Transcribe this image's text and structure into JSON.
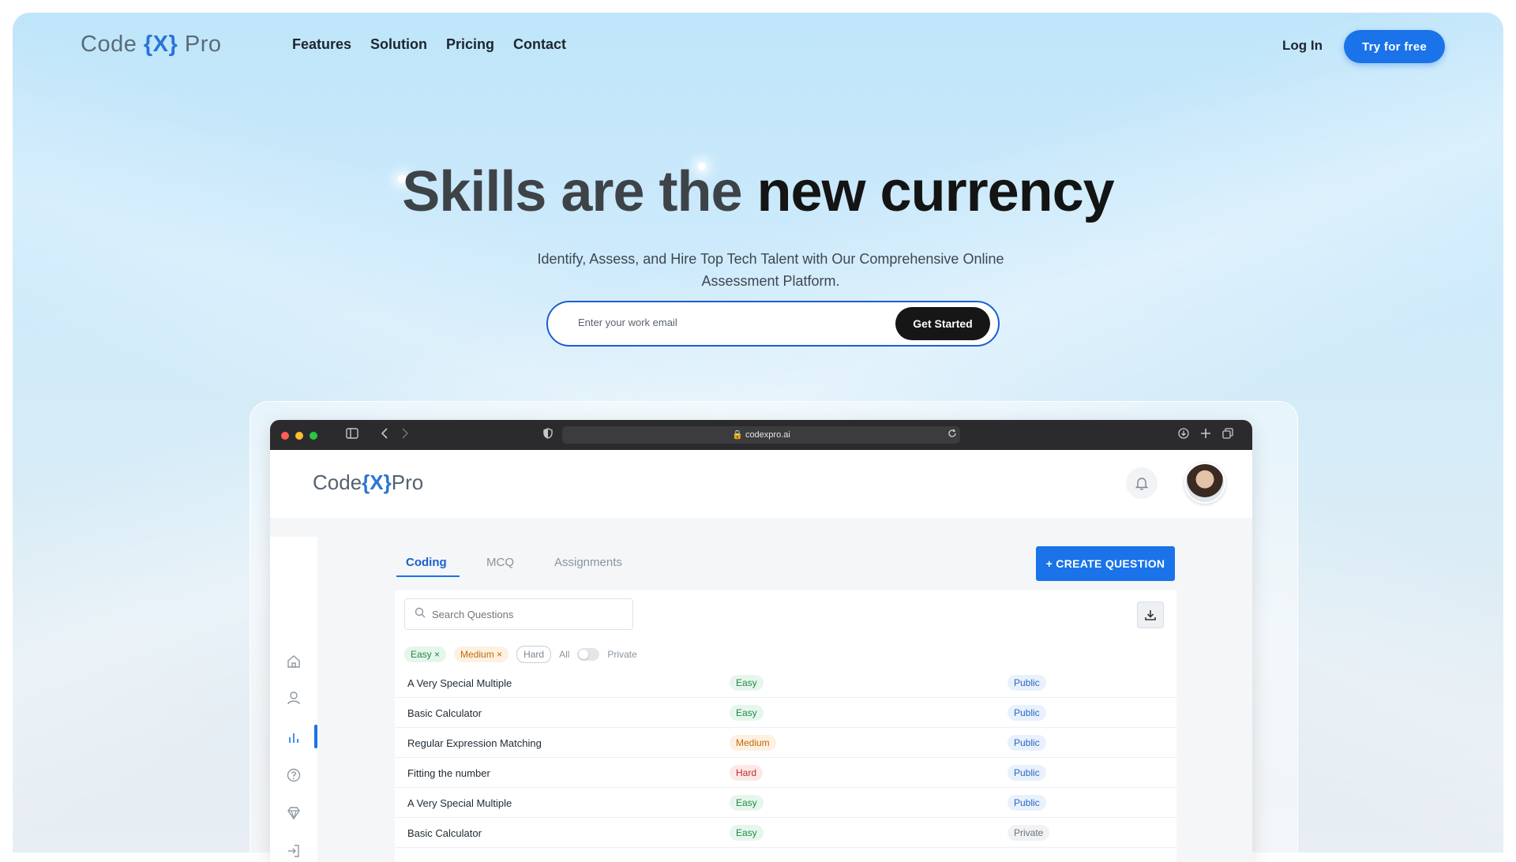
{
  "nav": {
    "brand_prefix": "Code ",
    "brand_x": "{X}",
    "brand_suffix": " Pro",
    "links": [
      "Features",
      "Solution",
      "Pricing",
      "Contact"
    ],
    "login": "Log In",
    "cta": "Try for free"
  },
  "hero": {
    "title_part1": "Skills are the",
    "title_part2": "new currency",
    "subtitle": "Identify, Assess, and Hire Top Tech Talent with Our Comprehensive Online Assessment Platform.",
    "email_placeholder": "Enter your work email",
    "get_started": "Get Started"
  },
  "browser": {
    "url": "codexpro.ai"
  },
  "app": {
    "brand_prefix": "Code",
    "brand_x": "{X}",
    "brand_suffix": "Pro",
    "tabs": [
      "Coding",
      "MCQ",
      "Assignments"
    ],
    "active_tab": "Coding",
    "create_button": "+ CREATE QUESTION",
    "search_placeholder": "Search Questions",
    "filters": {
      "easy": "Easy ×",
      "medium": "Medium ×",
      "hard": "Hard",
      "all": "All",
      "private": "Private"
    },
    "questions": [
      {
        "title": "A Very Special Multiple",
        "difficulty": "Easy",
        "visibility": "Public"
      },
      {
        "title": "Basic Calculator",
        "difficulty": "Easy",
        "visibility": "Public"
      },
      {
        "title": "Regular Expression Matching",
        "difficulty": "Medium",
        "visibility": "Public"
      },
      {
        "title": "Fitting the number",
        "difficulty": "Hard",
        "visibility": "Public"
      },
      {
        "title": "A Very Special Multiple",
        "difficulty": "Easy",
        "visibility": "Public"
      },
      {
        "title": "Basic Calculator",
        "difficulty": "Easy",
        "visibility": "Private"
      }
    ]
  },
  "colors": {
    "accent": "#1a73e8",
    "dark_button": "#161616",
    "easy": "#1c8a45",
    "medium": "#c26a08",
    "hard": "#c62828"
  }
}
